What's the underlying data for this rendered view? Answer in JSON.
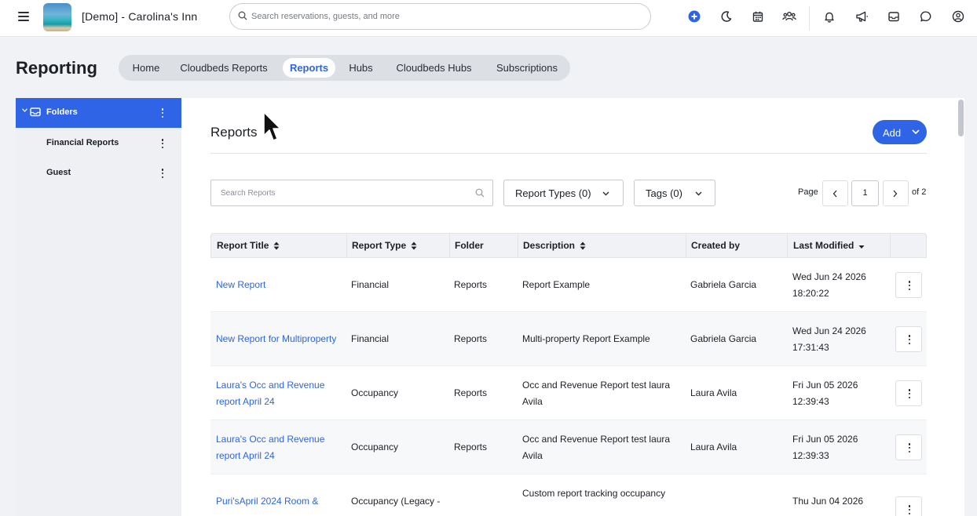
{
  "topbar": {
    "property_name": "[Demo] - Carolina's Inn",
    "search_placeholder": "Search reservations, guests, and more",
    "icons": [
      "menu-icon",
      "property-logo",
      "search-icon",
      "add-circle-icon",
      "moon-icon",
      "calendar-icon",
      "users-icon",
      "bell-icon",
      "megaphone-icon",
      "inbox-icon",
      "chat-icon",
      "user-account-icon"
    ],
    "accent_color": "#2e64e5"
  },
  "page": {
    "title": "Reporting",
    "tabs": [
      {
        "label": "Home",
        "active": false
      },
      {
        "label": "Cloudbeds Reports",
        "active": false
      },
      {
        "label": "Reports",
        "active": true
      },
      {
        "label": "Hubs",
        "active": false
      },
      {
        "label": "Cloudbeds Hubs",
        "active": false
      },
      {
        "label": "Subscriptions",
        "active": false
      }
    ]
  },
  "sidebar": {
    "root": {
      "label": "Folders"
    },
    "items": [
      {
        "label": "Financial Reports"
      },
      {
        "label": "Guest"
      }
    ]
  },
  "main": {
    "title": "Reports",
    "add_label": "Add",
    "search_placeholder": "Search Reports",
    "report_types_label": "Report Types (0)",
    "tags_label": "Tags (0)",
    "pager": {
      "page_label": "Page",
      "current": "1",
      "of_label": "of 2"
    },
    "columns": [
      "Report Title",
      "Report Type",
      "Folder",
      "Description",
      "Created by",
      "Last Modified"
    ],
    "rows": [
      {
        "title_1": "New Report",
        "title_2": "",
        "type_1": "Financial",
        "type_2": "",
        "folder": "Reports",
        "desc_1": "Report Example",
        "desc_2": "",
        "created_by": "Gabriela Garcia",
        "mod_date": "Wed Jun 24 2026",
        "mod_time": "18:20:22"
      },
      {
        "title_1": "New Report for Multiproperty",
        "title_2": "",
        "type_1": "Financial",
        "type_2": "",
        "folder": "Reports",
        "desc_1": "Multi-property Report Example",
        "desc_2": "",
        "created_by": "Gabriela Garcia",
        "mod_date": "Wed Jun 24 2026",
        "mod_time": "17:31:43"
      },
      {
        "title_1": "Laura's Occ and Revenue",
        "title_2": "report April 24",
        "type_1": "Occupancy",
        "type_2": "",
        "folder": "Reports",
        "desc_1": "Occ and Revenue Report test laura",
        "desc_2": "Avila",
        "created_by": "Laura Avila",
        "mod_date": "Fri Jun 05 2026",
        "mod_time": "12:39:43"
      },
      {
        "title_1": "Laura's Occ and Revenue",
        "title_2": "report April 24",
        "type_1": "Occupancy",
        "type_2": "",
        "folder": "Reports",
        "desc_1": "Occ and Revenue Report test laura",
        "desc_2": "Avila",
        "created_by": "Laura Avila",
        "mod_date": "Fri Jun 05 2026",
        "mod_time": "12:39:33"
      },
      {
        "title_1": "Puri'sApril 2024 Room &",
        "title_2": "",
        "type_1": "Occupancy (Legacy -",
        "type_2": "",
        "folder": "",
        "desc_1": "Custom report tracking occupancy",
        "desc_2": "",
        "created_by": "",
        "mod_date": "Thu Jun 04 2026",
        "mod_time": ""
      }
    ]
  }
}
